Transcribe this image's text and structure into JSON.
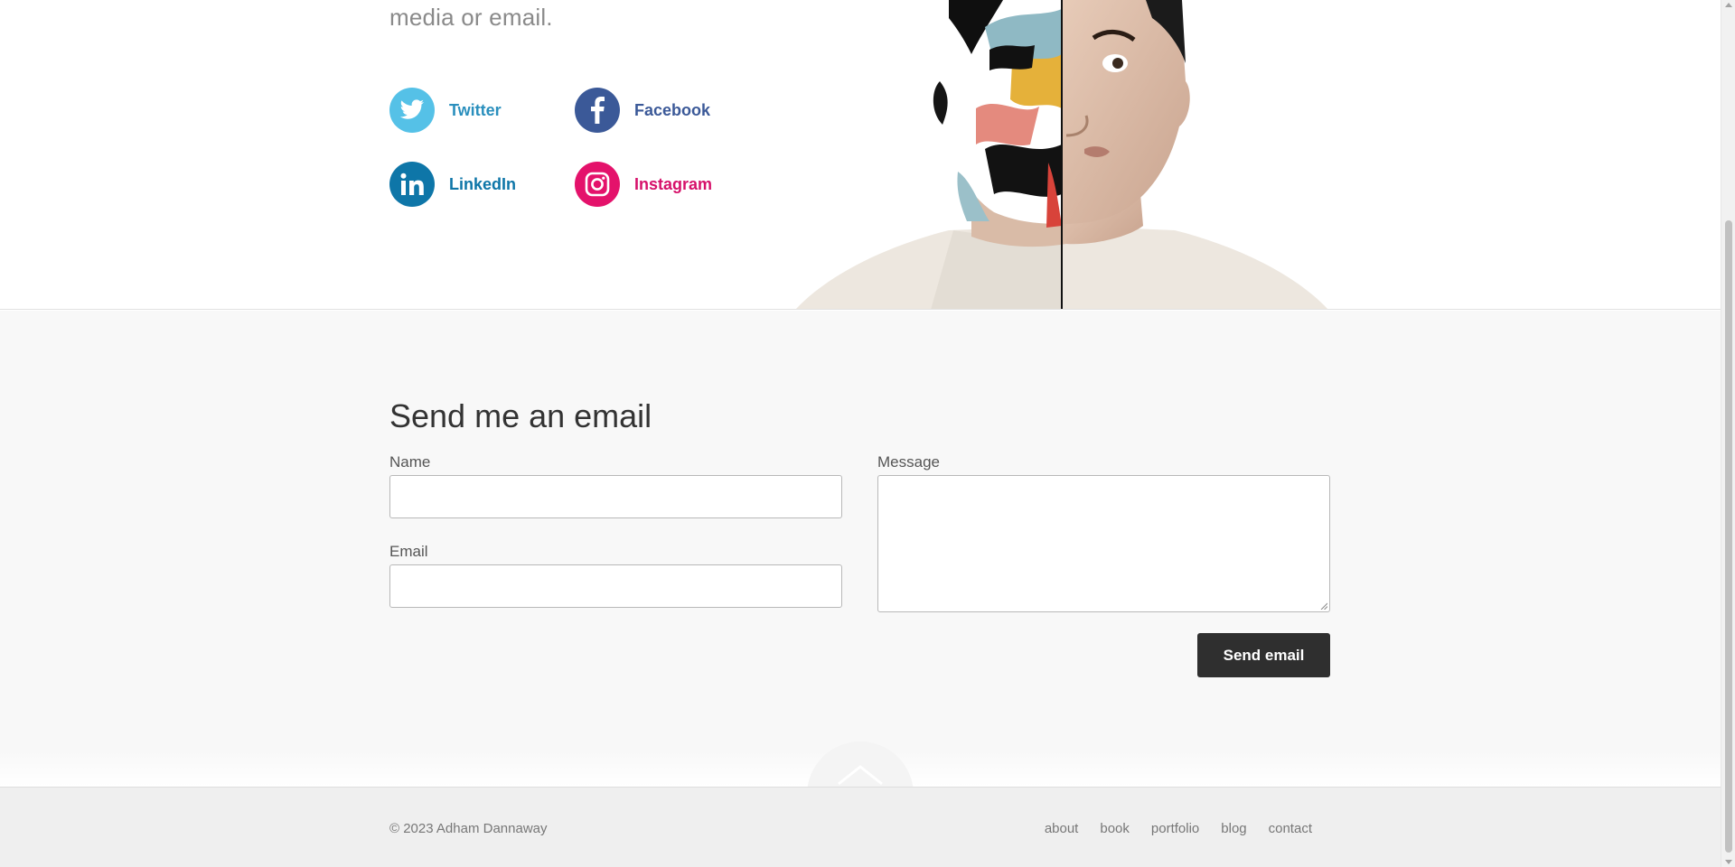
{
  "intro": {
    "tail_text": "media or email."
  },
  "social": {
    "twitter": {
      "label": "Twitter",
      "icon": "twitter-bird-icon",
      "color": "#55c1e7"
    },
    "facebook": {
      "label": "Facebook",
      "icon": "facebook-f-icon",
      "color": "#3b5998"
    },
    "linkedin": {
      "label": "LinkedIn",
      "icon": "linkedin-in-icon",
      "color": "#0e76a8"
    },
    "instagram": {
      "label": "Instagram",
      "icon": "instagram-camera-icon",
      "color": "#e4126b"
    }
  },
  "portrait": {
    "description_icon": "half-painted-face-portrait"
  },
  "contact_form": {
    "title": "Send me an email",
    "name_label": "Name",
    "name_value": "",
    "email_label": "Email",
    "email_value": "",
    "message_label": "Message",
    "message_value": "",
    "submit_label": "Send email"
  },
  "back_to_top": {
    "icon": "chevron-up-icon"
  },
  "footer": {
    "copyright": "© 2023 Adham Dannaway",
    "nav": [
      "about",
      "book",
      "portfolio",
      "blog",
      "contact"
    ]
  },
  "colors": {
    "button_bg": "#2f2f2f",
    "section_bg": "#f8f8f8",
    "footer_bg": "#efefef"
  }
}
